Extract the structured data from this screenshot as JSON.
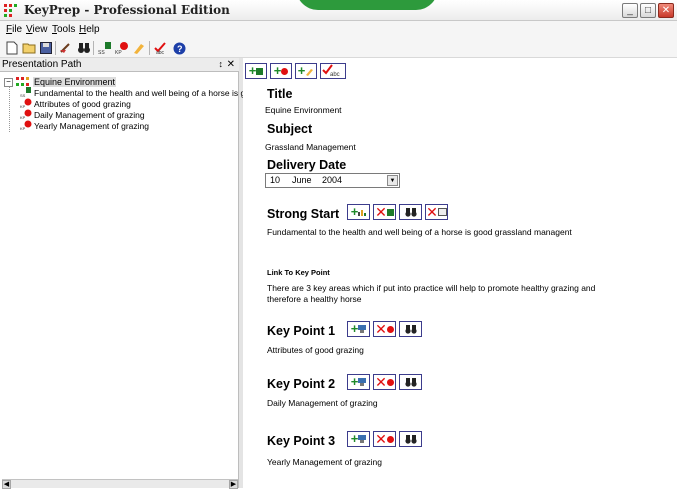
{
  "window": {
    "title": "KeyPrep - Professional Edition"
  },
  "menu": {
    "items": [
      "File",
      "View",
      "Tools",
      "Help"
    ]
  },
  "toolbar": {
    "icons": [
      "new-file-icon",
      "open-folder-icon",
      "save-disk-icon",
      "broom-icon",
      "binoculars-icon",
      "strong-start-icon",
      "key-point-icon",
      "finish-icon",
      "spell-check-icon",
      "help-icon"
    ]
  },
  "left_panel": {
    "title": "Presentation Path",
    "pin": "↕",
    "close": "✕",
    "tree": {
      "root": "Equine Environment",
      "children": [
        "Fundamental to the health and well being of a horse is good",
        "Attributes of good grazing",
        "Daily Management of grazing",
        "Yearly Management of grazing"
      ]
    }
  },
  "main": {
    "title_label": "Title",
    "title_value": "Equine Environment",
    "subject_label": "Subject",
    "subject_value": "Grassland Management",
    "delivery_label": "Delivery Date",
    "date": {
      "day": "10",
      "month": "June",
      "year": "2004"
    },
    "strong_start_label": "Strong Start",
    "strong_start_text": "Fundamental to the health and well being of a horse is good grassland managent",
    "link_label": "Link To Key Point",
    "link_text_1": "There are 3 key areas which if put into practice will help to promote healthy grazing and",
    "link_text_2": "therefore a healthy horse",
    "key_points": [
      {
        "label": "Key Point 1",
        "text": "Attributes of good grazing"
      },
      {
        "label": "Key Point 2",
        "text": "Daily Management of grazing"
      },
      {
        "label": "Key Point 3",
        "text": "Yearly Management of grazing"
      }
    ]
  },
  "colors": {
    "accent_green": "#2d9a3c",
    "button_border": "#3c3c8c",
    "delete_red": "#e01010",
    "add_green": "#1f8a2a"
  }
}
